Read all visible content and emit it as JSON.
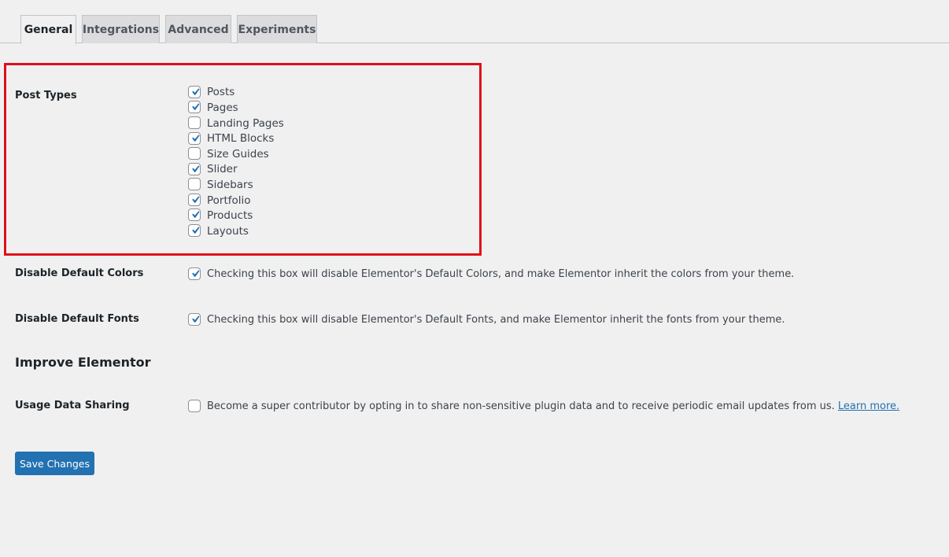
{
  "tabs": [
    {
      "label": "General",
      "active": true
    },
    {
      "label": "Integrations",
      "active": false
    },
    {
      "label": "Advanced",
      "active": false
    },
    {
      "label": "Experiments",
      "active": false
    }
  ],
  "post_types": {
    "label": "Post Types",
    "items": [
      {
        "label": "Posts",
        "checked": true
      },
      {
        "label": "Pages",
        "checked": true
      },
      {
        "label": "Landing Pages",
        "checked": false
      },
      {
        "label": "HTML Blocks",
        "checked": true
      },
      {
        "label": "Size Guides",
        "checked": false
      },
      {
        "label": "Slider",
        "checked": true
      },
      {
        "label": "Sidebars",
        "checked": false
      },
      {
        "label": "Portfolio",
        "checked": true
      },
      {
        "label": "Products",
        "checked": true
      },
      {
        "label": "Layouts",
        "checked": true
      }
    ]
  },
  "disable_colors": {
    "label": "Disable Default Colors",
    "text": "Checking this box will disable Elementor's Default Colors, and make Elementor inherit the colors from your theme.",
    "checked": true
  },
  "disable_fonts": {
    "label": "Disable Default Fonts",
    "text": "Checking this box will disable Elementor's Default Fonts, and make Elementor inherit the fonts from your theme.",
    "checked": true
  },
  "improve": {
    "heading": "Improve Elementor",
    "usage_label": "Usage Data Sharing",
    "usage_text": "Become a super contributor by opting in to share non-sensitive plugin data and to receive periodic email updates from us. ",
    "learn_more": "Learn more.",
    "checked": false
  },
  "save_label": "Save Changes",
  "colors": {
    "accent": "#2271b1",
    "highlight_border": "#e0101a",
    "background": "#f0f0f1"
  }
}
